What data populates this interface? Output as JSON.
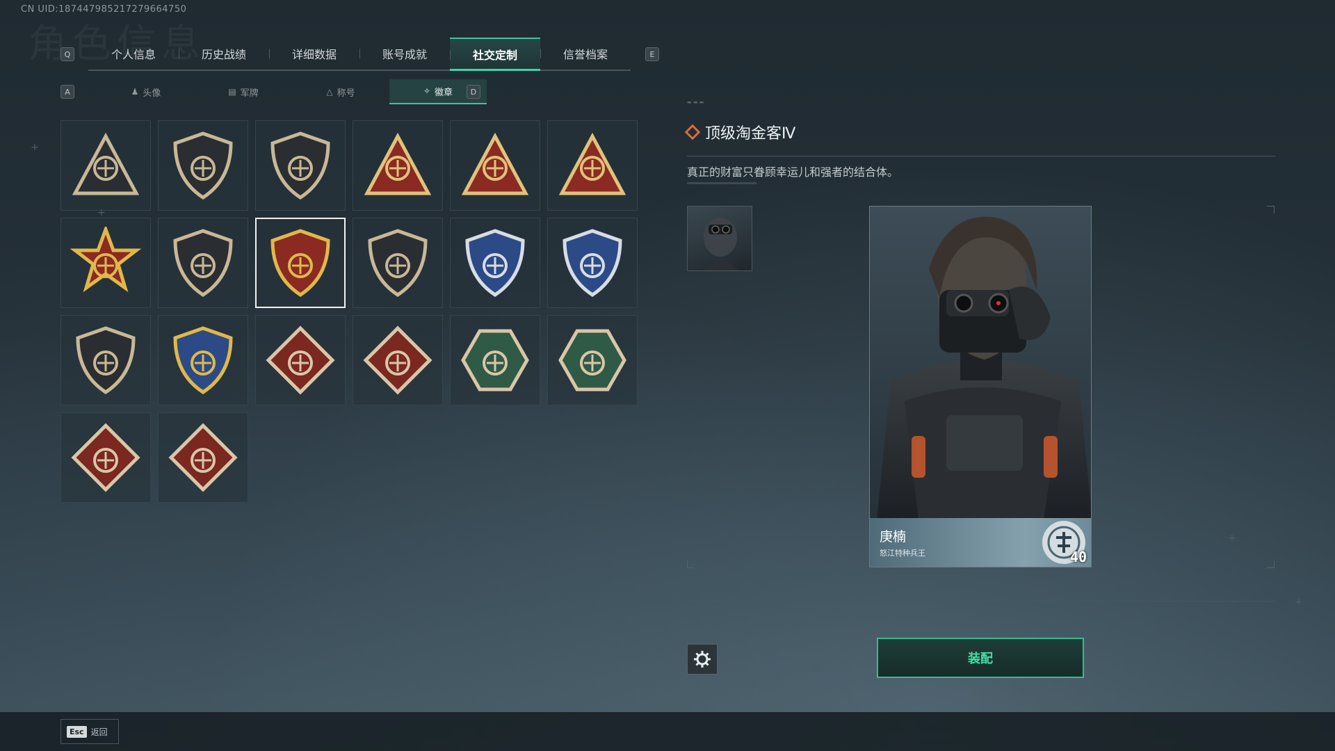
{
  "uid": "CN UID:18744798521727966​4750",
  "ghost_title": "角色信息",
  "main_tabs": {
    "key_left": "Q",
    "key_right": "E",
    "items": [
      "个人信息",
      "历史战绩",
      "详细数据",
      "账号成就",
      "社交定制",
      "信誉档案"
    ],
    "active_index": 4
  },
  "sub_tabs": {
    "key_left": "A",
    "key_right": "D",
    "items": [
      {
        "icon": "person-icon",
        "label": "头像"
      },
      {
        "icon": "plate-icon",
        "label": "军牌"
      },
      {
        "icon": "title-icon",
        "label": "称号"
      },
      {
        "icon": "badge-icon",
        "label": "徽章"
      }
    ],
    "active_index": 3
  },
  "badges": [
    {
      "icon": "shield-triangle-icon",
      "color": "#2a2e33",
      "accent": "#c8b896"
    },
    {
      "icon": "shield-helicopter-icon",
      "color": "#2a2e33",
      "accent": "#c8b896"
    },
    {
      "icon": "shield-dagger-icon",
      "color": "#2a2e33",
      "accent": "#c8b896"
    },
    {
      "icon": "triangle-nest-icon",
      "color": "#8a2a23",
      "accent": "#e0c27a"
    },
    {
      "icon": "triangle-one-icon",
      "color": "#8a2a23",
      "accent": "#e0c27a"
    },
    {
      "icon": "triangle-tower-icon",
      "color": "#8a2a23",
      "accent": "#e0c27a"
    },
    {
      "icon": "star-skull-emblem-icon",
      "color": "#8a2a23",
      "accent": "#e0b84a"
    },
    {
      "icon": "shield-wings-icon",
      "color": "#2a2e33",
      "accent": "#c8b896"
    },
    {
      "icon": "laurel-shield-icon",
      "color": "#8a2a23",
      "accent": "#e0b84a"
    },
    {
      "icon": "shield-gem-icon",
      "color": "#2a2e33",
      "accent": "#c8b896"
    },
    {
      "icon": "crosshair-rifle-shield-icon",
      "color": "#2c4a86",
      "accent": "#d6dde6"
    },
    {
      "icon": "crosshair-rifle-shield-icon",
      "color": "#2c4a86",
      "accent": "#d6dde6"
    },
    {
      "icon": "shield-rifle-icon",
      "color": "#2a2e33",
      "accent": "#c8b896"
    },
    {
      "icon": "gold-crosshair-shield-icon",
      "color": "#2c4a86",
      "accent": "#e0b84a"
    },
    {
      "icon": "wolf-diamond-icon",
      "color": "#7a2820",
      "accent": "#d9c6a8"
    },
    {
      "icon": "wolf-diamond-icon",
      "color": "#7a2820",
      "accent": "#d9c6a8"
    },
    {
      "icon": "wasp-hexagon-icon",
      "color": "#2f5a46",
      "accent": "#d9c6a8"
    },
    {
      "icon": "figure-hexagon-icon",
      "color": "#2f5a46",
      "accent": "#d9c6a8"
    },
    {
      "icon": "dragon-diamond-icon",
      "color": "#7a2820",
      "accent": "#d9c6a8"
    },
    {
      "icon": "runner-diamond-icon",
      "color": "#7a2820",
      "accent": "#d9c6a8"
    }
  ],
  "selected_badge_index": 8,
  "detail": {
    "title": "顶级淘金客Ⅳ",
    "description": "真正的财富只眷顾幸运儿和强者的结合体。",
    "equip_label": "装配"
  },
  "card": {
    "name": "庚楠",
    "subtitle": "怒江特种兵王",
    "level": "40"
  },
  "footer": {
    "esc_key": "Esc",
    "back_label": "返回"
  },
  "colors": {
    "accent_green": "#3bc6a0",
    "title_diamond": "#d96c3a"
  }
}
